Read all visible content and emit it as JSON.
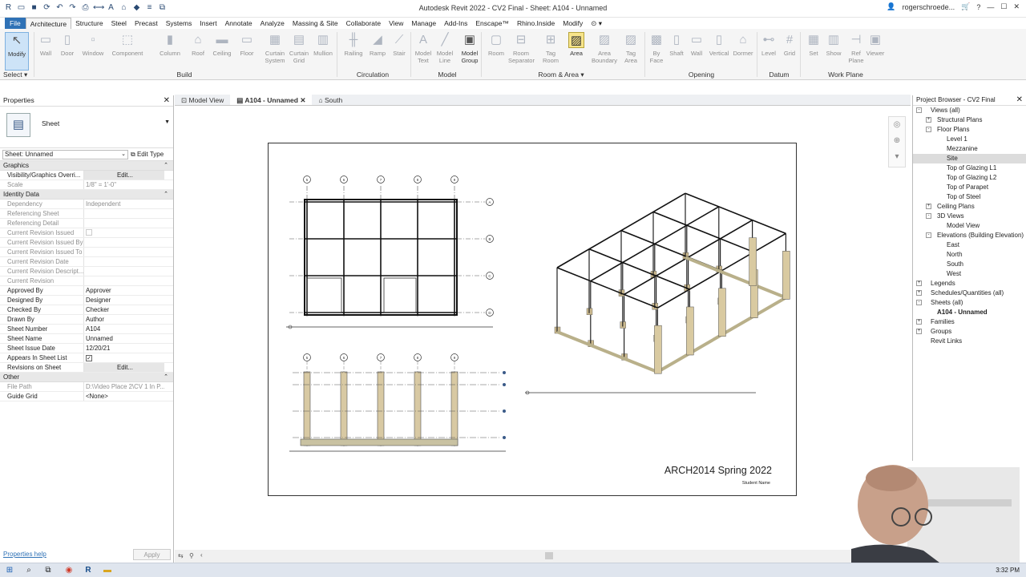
{
  "app": {
    "title": "Autodesk Revit 2022 - CV2 Final - Sheet: A104 - Unnamed",
    "user": "rogerschroede...",
    "help": "?"
  },
  "menu": [
    "File",
    "Architecture",
    "Structure",
    "Steel",
    "Precast",
    "Systems",
    "Insert",
    "Annotate",
    "Analyze",
    "Massing & Site",
    "Collaborate",
    "View",
    "Manage",
    "Add-Ins",
    "Enscape™",
    "Rhino.Inside",
    "Modify",
    "⊙ ▾"
  ],
  "ribbon": {
    "tools": [
      {
        "label": "Modify",
        "icon": "arrow-cursor-icon",
        "enabled": true
      },
      {
        "label": "Wall"
      },
      {
        "label": "Door"
      },
      {
        "label": "Window"
      },
      {
        "label": "Component"
      },
      {
        "label": "Column"
      },
      {
        "label": "Roof"
      },
      {
        "label": "Ceiling"
      },
      {
        "label": "Floor"
      },
      {
        "label": "Curtain System"
      },
      {
        "label": "Curtain Grid"
      },
      {
        "label": "Mullion"
      },
      {
        "label": "Railing"
      },
      {
        "label": "Ramp"
      },
      {
        "label": "Stair"
      },
      {
        "label": "Model Text"
      },
      {
        "label": "Model Line"
      },
      {
        "label": "Model Group",
        "enabled": true
      },
      {
        "label": "Room"
      },
      {
        "label": "Room Separator"
      },
      {
        "label": "Tag Room"
      },
      {
        "label": "Area",
        "enabled": true
      },
      {
        "label": "Area Boundary"
      },
      {
        "label": "Tag Area"
      },
      {
        "label": "By Face"
      },
      {
        "label": "Shaft"
      },
      {
        "label": "Wall"
      },
      {
        "label": "Vertical"
      },
      {
        "label": "Dormer"
      },
      {
        "label": "Level"
      },
      {
        "label": "Grid"
      },
      {
        "label": "Set"
      },
      {
        "label": "Show"
      },
      {
        "label": "Ref Plane"
      },
      {
        "label": "Viewer"
      }
    ],
    "groups": [
      "Select ▾",
      "Build",
      "Circulation",
      "Model",
      "Room & Area ▾",
      "Opening",
      "Datum",
      "Work Plane"
    ]
  },
  "properties": {
    "title": "Properties",
    "type_name": "Sheet",
    "selector": "Sheet: Unnamed",
    "edit_type": "Edit Type",
    "sections": [
      {
        "name": "Graphics",
        "rows": [
          {
            "k": "Visibility/Graphics Overri...",
            "v": "Edit...",
            "btn": true
          },
          {
            "k": "Scale",
            "v": "1/8\" = 1'-0\"",
            "ro": true
          }
        ]
      },
      {
        "name": "Identity Data",
        "rows": [
          {
            "k": "Dependency",
            "v": "Independent",
            "ro": true
          },
          {
            "k": "Referencing Sheet",
            "v": "",
            "ro": true
          },
          {
            "k": "Referencing Detail",
            "v": "",
            "ro": true
          },
          {
            "k": "Current Revision Issued",
            "v": "",
            "ro": true,
            "check": "off"
          },
          {
            "k": "Current Revision Issued By",
            "v": "",
            "ro": true
          },
          {
            "k": "Current Revision Issued To",
            "v": "",
            "ro": true
          },
          {
            "k": "Current Revision Date",
            "v": "",
            "ro": true
          },
          {
            "k": "Current Revision Descript...",
            "v": "",
            "ro": true
          },
          {
            "k": "Current Revision",
            "v": "",
            "ro": true
          },
          {
            "k": "Approved By",
            "v": "Approver"
          },
          {
            "k": "Designed By",
            "v": "Designer"
          },
          {
            "k": "Checked By",
            "v": "Checker"
          },
          {
            "k": "Drawn By",
            "v": "Author"
          },
          {
            "k": "Sheet Number",
            "v": "A104"
          },
          {
            "k": "Sheet Name",
            "v": "Unnamed"
          },
          {
            "k": "Sheet Issue Date",
            "v": "12/20/21"
          },
          {
            "k": "Appears In Sheet List",
            "v": "",
            "check": "on"
          },
          {
            "k": "Revisions on Sheet",
            "v": "Edit...",
            "btn": true
          }
        ]
      },
      {
        "name": "Other",
        "rows": [
          {
            "k": "File Path",
            "v": "D:\\Video Place 2\\CV 1 In P...",
            "ro": true
          },
          {
            "k": "Guide Grid",
            "v": "<None>"
          }
        ]
      }
    ],
    "help_link": "Properties help",
    "apply": "Apply"
  },
  "view_tabs": [
    {
      "label": "Model View",
      "active": false
    },
    {
      "label": "A104 - Unnamed",
      "active": true
    },
    {
      "label": "South",
      "active": false
    }
  ],
  "sheet": {
    "title_block": "ARCH2014 Spring 2022",
    "student": "Student Name",
    "grid_top": [
      "5",
      "6",
      "7",
      "8",
      "9"
    ],
    "grid_side": [
      "A",
      "B",
      "C",
      "D"
    ]
  },
  "browser": {
    "title": "Project Browser - CV2 Final",
    "nodes": [
      {
        "label": "Views (all)",
        "d": 0,
        "exp": "-"
      },
      {
        "label": "Structural Plans",
        "d": 1,
        "exp": "+"
      },
      {
        "label": "Floor Plans",
        "d": 1,
        "exp": "-"
      },
      {
        "label": "Level 1",
        "d": 2
      },
      {
        "label": "Mezzanine",
        "d": 2
      },
      {
        "label": "Site",
        "d": 2,
        "sel": true
      },
      {
        "label": "Top of Glazing L1",
        "d": 2
      },
      {
        "label": "Top of Glazing L2",
        "d": 2
      },
      {
        "label": "Top of Parapet",
        "d": 2
      },
      {
        "label": "Top of Steel",
        "d": 2
      },
      {
        "label": "Ceiling Plans",
        "d": 1,
        "exp": "+"
      },
      {
        "label": "3D Views",
        "d": 1,
        "exp": "-"
      },
      {
        "label": "Model View",
        "d": 2
      },
      {
        "label": "Elevations (Building Elevation)",
        "d": 1,
        "exp": "-"
      },
      {
        "label": "East",
        "d": 2
      },
      {
        "label": "North",
        "d": 2
      },
      {
        "label": "South",
        "d": 2
      },
      {
        "label": "West",
        "d": 2
      },
      {
        "label": "Legends",
        "d": 0,
        "exp": "+"
      },
      {
        "label": "Schedules/Quantities (all)",
        "d": 0,
        "exp": "+"
      },
      {
        "label": "Sheets (all)",
        "d": 0,
        "exp": "-"
      },
      {
        "label": "A104 - Unnamed",
        "d": 1,
        "bold": true
      },
      {
        "label": "Families",
        "d": 0,
        "exp": "+"
      },
      {
        "label": "Groups",
        "d": 0,
        "exp": "+"
      },
      {
        "label": "Revit Links",
        "d": 0
      }
    ]
  },
  "taskbar": {
    "time": "3:32 PM"
  }
}
